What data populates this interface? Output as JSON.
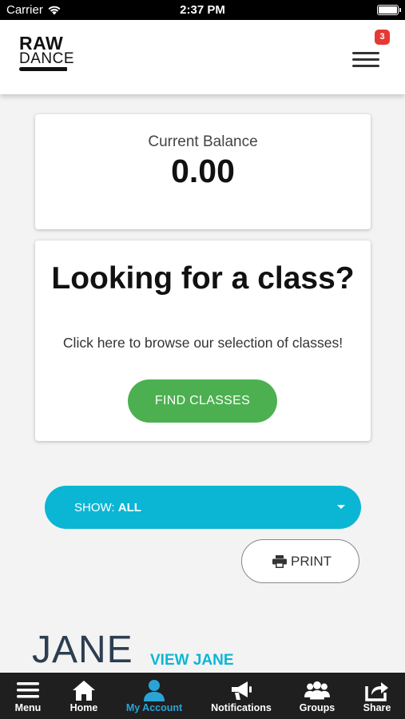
{
  "status_bar": {
    "carrier": "Carrier",
    "time": "2:37 PM"
  },
  "header": {
    "logo_top": "RAW",
    "logo_bottom": "DANCE",
    "notification_count": "3"
  },
  "balance": {
    "label": "Current Balance",
    "value": "0.00"
  },
  "class_card": {
    "title": "Looking for a class?",
    "subtitle": "Click here to browse our selection of classes!",
    "button_label": "FIND CLASSES"
  },
  "filter": {
    "prefix": "SHOW:",
    "value": "ALL"
  },
  "print": {
    "label": "PRINT"
  },
  "member": {
    "name": "JANE",
    "link": "VIEW JANE"
  },
  "tabbar": {
    "active_color": "#2aa4d6",
    "tabs": [
      {
        "label": "Menu",
        "icon": "hamburger-icon"
      },
      {
        "label": "Home",
        "icon": "home-icon"
      },
      {
        "label": "My Account",
        "icon": "user-icon",
        "active": true
      },
      {
        "label": "Notifications",
        "icon": "megaphone-icon"
      },
      {
        "label": "Groups",
        "icon": "group-icon"
      },
      {
        "label": "Share",
        "icon": "share-icon"
      }
    ]
  },
  "colors": {
    "accent": "#0bb6d4",
    "success": "#4cb050",
    "badge": "#e53935"
  }
}
